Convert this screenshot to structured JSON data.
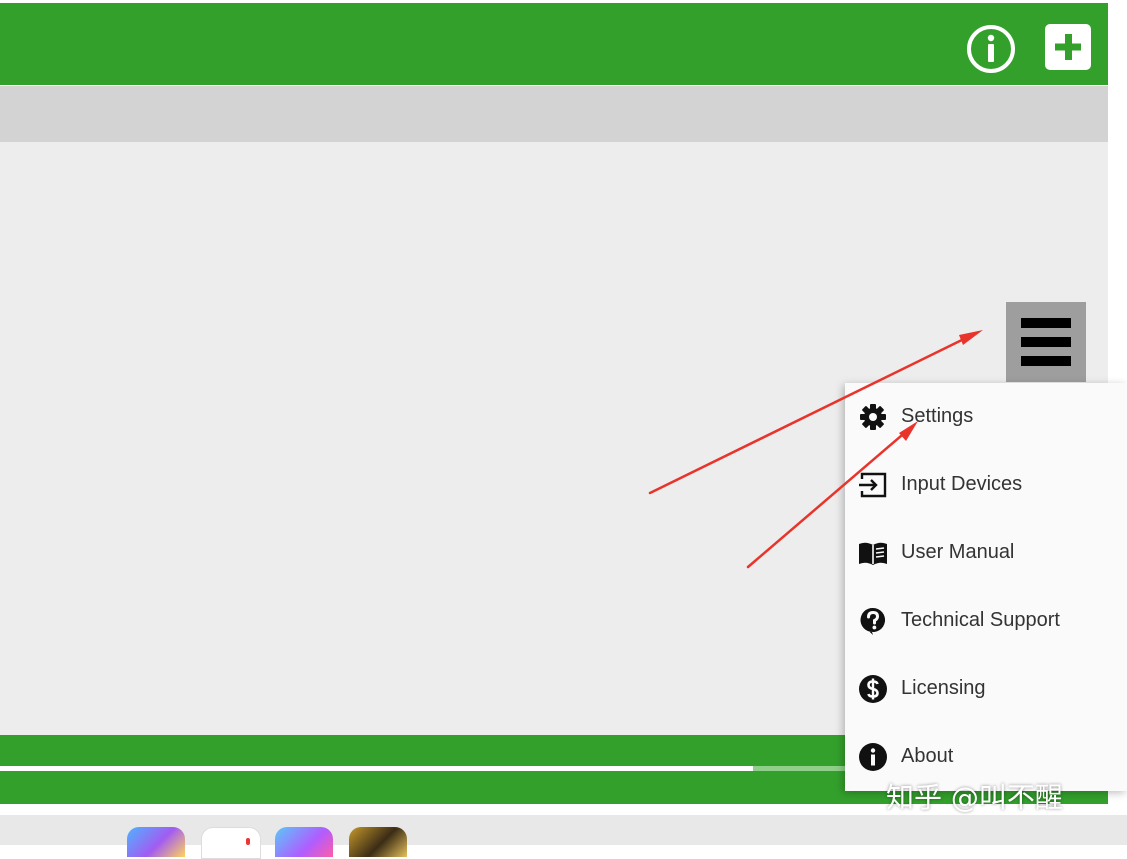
{
  "colors": {
    "header": "#33a02c",
    "subbar": "#d3d3d3",
    "canvas": "#ededed",
    "menu_button": "#9e9e9e",
    "annotation_arrow": "#e8342b"
  },
  "header": {
    "info_icon": "info-circle-icon",
    "add_icon": "plus-icon"
  },
  "progress": {
    "fraction": 0.68
  },
  "menu_button": {
    "icon": "hamburger-icon"
  },
  "dropdown": {
    "items": [
      {
        "label": "Settings",
        "icon": "gear-icon"
      },
      {
        "label": "Input Devices",
        "icon": "input-icon"
      },
      {
        "label": "User Manual",
        "icon": "book-icon"
      },
      {
        "label": "Technical Support",
        "icon": "question-bubble-icon"
      },
      {
        "label": "Licensing",
        "icon": "dollar-circle-icon"
      },
      {
        "label": "About",
        "icon": "info-icon"
      }
    ]
  },
  "watermark": {
    "text": "知乎 @叫不醒"
  }
}
